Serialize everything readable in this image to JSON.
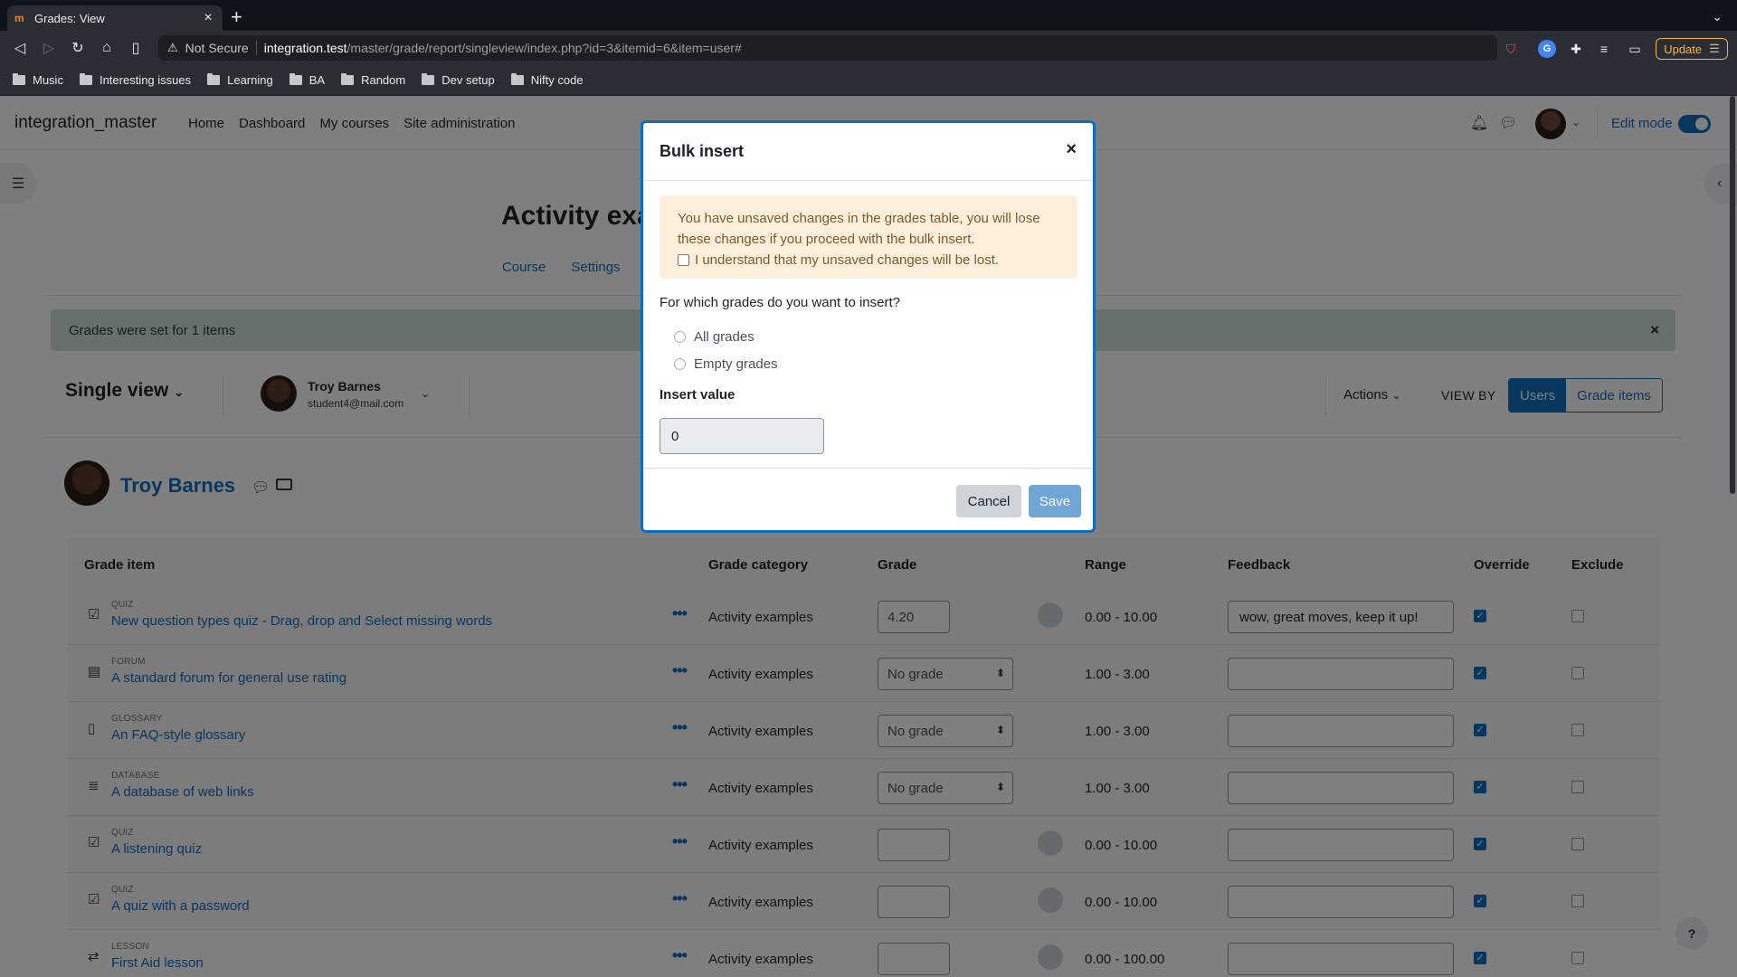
{
  "browser": {
    "tab_title": "Grades: View",
    "tab_close": "×",
    "new_tab": "+",
    "tab_menu": "⌄",
    "security_label": "Not Secure",
    "url_host": "integration.test",
    "url_path": "/master/grade/report/singleview/index.php?id=3&itemid=6&item=user#",
    "update_label": "Update",
    "bookmarks": [
      "Music",
      "Interesting issues",
      "Learning",
      "BA",
      "Random",
      "Dev setup",
      "Nifty code"
    ]
  },
  "moodle": {
    "site_name": "integration_master",
    "nav_items": [
      "Home",
      "Dashboard",
      "My courses",
      "Site administration"
    ],
    "edit_mode_label": "Edit mode",
    "edit_mode_on": true,
    "course_title": "Activity exa",
    "secondary_nav": [
      "Course",
      "Settings"
    ],
    "alert_text": "Grades were set for 1 items",
    "alert_close": "×",
    "single_view_label": "Single view",
    "selected_user": {
      "name": "Troy Barnes",
      "email": "student4@mail.com"
    },
    "actions_label": "Actions",
    "view_by_label": "VIEW BY",
    "view_by_options": [
      "Users",
      "Grade items"
    ],
    "view_by_active": "Users",
    "user_heading": "Troy Barnes",
    "help_label": "?"
  },
  "table": {
    "headers": [
      "Grade item",
      "Grade category",
      "Grade",
      "Range",
      "Feedback",
      "Override",
      "Exclude"
    ],
    "rows": [
      {
        "type": "QUIZ",
        "name": "New question types quiz - Drag, drop and Select missing words",
        "category": "Activity examples",
        "grade_kind": "input",
        "grade": "4.20",
        "range": "0.00 - 10.00",
        "feedback": "wow, great moves, keep it up!",
        "override": true,
        "exclude": false,
        "icon": "quiz-icon"
      },
      {
        "type": "FORUM",
        "name": "A standard forum for general use rating",
        "category": "Activity examples",
        "grade_kind": "select",
        "grade": "No grade",
        "range": "1.00 - 3.00",
        "feedback": "",
        "override": true,
        "exclude": false,
        "icon": "forum-icon"
      },
      {
        "type": "GLOSSARY",
        "name": "An FAQ-style glossary",
        "category": "Activity examples",
        "grade_kind": "select",
        "grade": "No grade",
        "range": "1.00 - 3.00",
        "feedback": "",
        "override": true,
        "exclude": false,
        "icon": "glossary-icon"
      },
      {
        "type": "DATABASE",
        "name": "A database of web links",
        "category": "Activity examples",
        "grade_kind": "select",
        "grade": "No grade",
        "range": "1.00 - 3.00",
        "feedback": "",
        "override": true,
        "exclude": false,
        "icon": "database-icon"
      },
      {
        "type": "QUIZ",
        "name": "A listening quiz",
        "category": "Activity examples",
        "grade_kind": "input",
        "grade": "",
        "range": "0.00 - 10.00",
        "feedback": "",
        "override": true,
        "exclude": false,
        "icon": "quiz-icon"
      },
      {
        "type": "QUIZ",
        "name": "A quiz with a password",
        "category": "Activity examples",
        "grade_kind": "input",
        "grade": "",
        "range": "0.00 - 10.00",
        "feedback": "",
        "override": true,
        "exclude": false,
        "icon": "quiz-icon"
      },
      {
        "type": "LESSON",
        "name": "First Aid lesson",
        "category": "Activity examples",
        "grade_kind": "input",
        "grade": "",
        "range": "0.00 - 100.00",
        "feedback": "",
        "override": true,
        "exclude": false,
        "icon": "lesson-icon"
      }
    ]
  },
  "modal": {
    "title": "Bulk insert",
    "close": "×",
    "warning_text": "You have unsaved changes in the grades table, you will lose these changes if you proceed with the bulk insert.",
    "warning_check_label": "I understand that my unsaved changes will be lost.",
    "question": "For which grades do you want to insert?",
    "options": [
      "All grades",
      "Empty grades"
    ],
    "insert_value_label": "Insert value",
    "insert_value": "0",
    "cancel_label": "Cancel",
    "save_label": "Save"
  },
  "colors": {
    "brand": "#0f6cbf",
    "alert_bg": "#cfe1d6",
    "warning_bg": "#fcefdc",
    "browser_chrome": "#2a2d33"
  }
}
